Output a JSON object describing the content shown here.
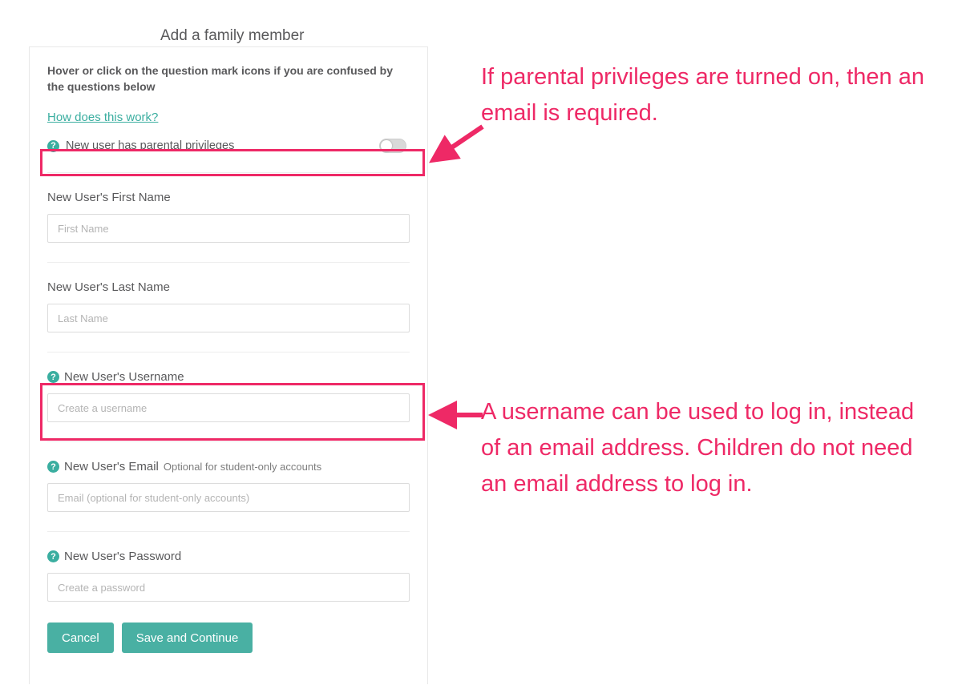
{
  "page_title": "Add a family member",
  "hint": "Hover or click on the question mark icons if you are confused by the questions below",
  "help_link": "How does this work?",
  "parental": {
    "label": "New user has parental privileges",
    "on": false
  },
  "fields": {
    "first_name": {
      "label": "New User's First Name",
      "placeholder": "First Name"
    },
    "last_name": {
      "label": "New User's Last Name",
      "placeholder": "Last Name"
    },
    "username": {
      "label": "New User's Username",
      "placeholder": "Create a username"
    },
    "email": {
      "label": "New User's Email",
      "sublabel": "Optional for student-only accounts",
      "placeholder": "Email (optional for student-only accounts)"
    },
    "password": {
      "label": "New User's Password",
      "placeholder": "Create a password"
    }
  },
  "buttons": {
    "cancel": "Cancel",
    "save": "Save and Continue"
  },
  "annotations": {
    "a1": "If parental privileges are turned on, then an email is required.",
    "a2": "A username can be used to log in, instead of an email address. Children do not need an email address to log in."
  },
  "colors": {
    "accent": "#3aaea0",
    "highlight": "#ee2966"
  }
}
